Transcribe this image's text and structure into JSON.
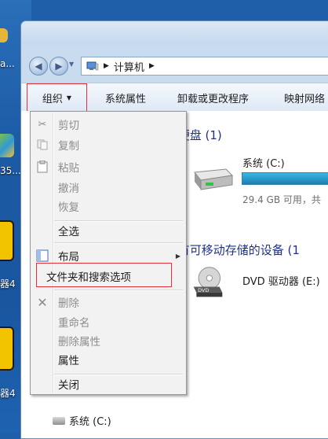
{
  "desktop": {
    "labels": [
      "a...",
      "35...",
      "器4",
      "器4"
    ]
  },
  "address": {
    "crumbs": [
      "计算机"
    ]
  },
  "toolbar": {
    "organize": "组织",
    "system_properties": "系统属性",
    "uninstall": "卸载或更改程序",
    "map_network": "映射网络"
  },
  "groups": {
    "hard_disks": "硬盘 (1)",
    "removable": "有可移动存储的设备 (1"
  },
  "drives": {
    "c_name": "系统 (C:)",
    "c_free": "29.4 GB 可用，共",
    "c_usage": 0.8,
    "dvd_name": "DVD 驱动器 (E:)"
  },
  "navpane": {
    "system_c": "系统 (C:)"
  },
  "menu": {
    "items": [
      {
        "label": "剪切",
        "enabled": false,
        "icon": "scissors-icon"
      },
      {
        "label": "复制",
        "enabled": false,
        "icon": "copy-icon"
      },
      {
        "label": "粘贴",
        "enabled": false,
        "icon": "paste-icon"
      },
      {
        "label": "撤消",
        "enabled": false
      },
      {
        "label": "恢复",
        "enabled": false
      },
      {
        "label": "全选",
        "enabled": true
      },
      {
        "label": "布局",
        "enabled": true,
        "icon": "layout-icon",
        "submenu": true
      },
      {
        "label": "文件夹和搜索选项",
        "enabled": true
      },
      {
        "label": "删除",
        "enabled": false,
        "icon": "delete-x-icon"
      },
      {
        "label": "重命名",
        "enabled": false
      },
      {
        "label": "删除属性",
        "enabled": false
      },
      {
        "label": "属性",
        "enabled": true
      },
      {
        "label": "关闭",
        "enabled": true
      }
    ]
  },
  "colors": {
    "highlight_border": "#e0323a",
    "group_title": "#1e3287",
    "drive_bar": "#26a0d8"
  }
}
